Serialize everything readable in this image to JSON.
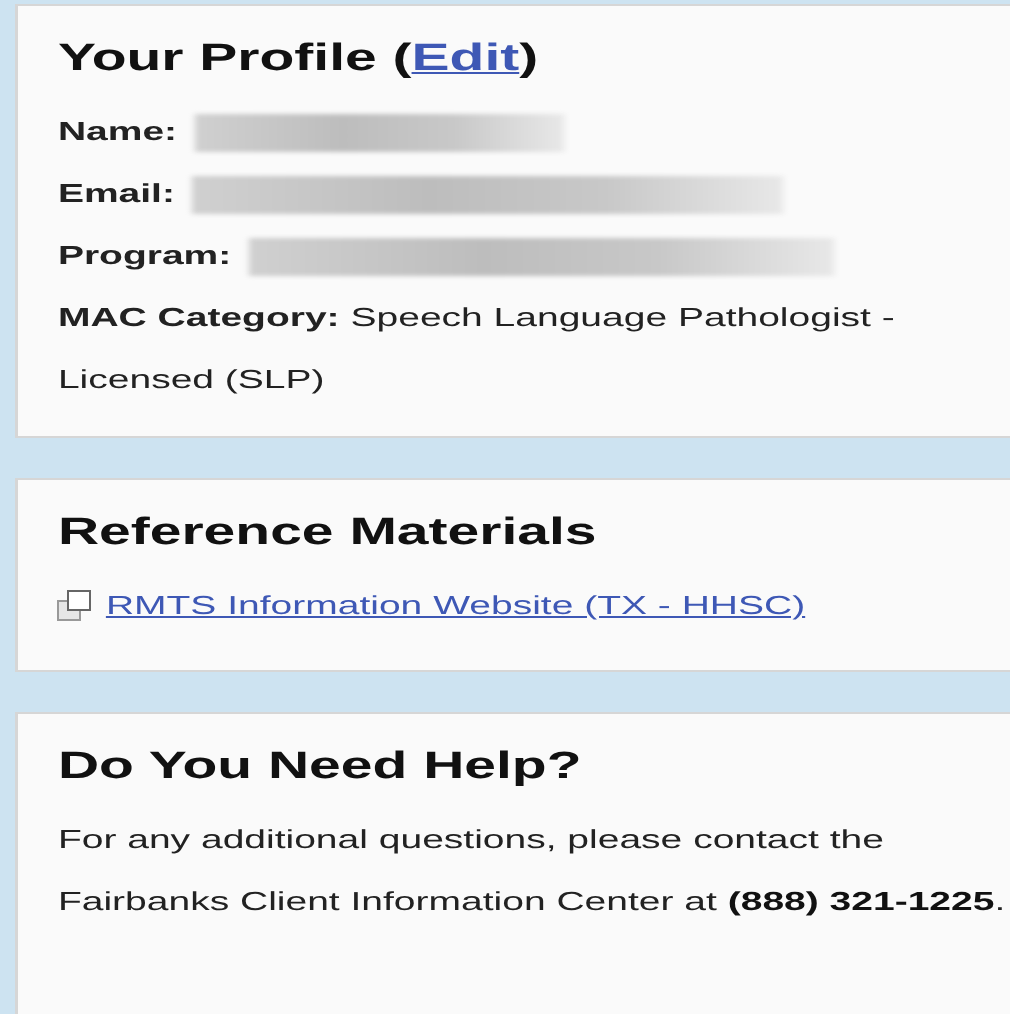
{
  "profile": {
    "title": "Your Profile (",
    "edit_link": "Edit",
    "title_end": ")",
    "fields": [
      {
        "label": "Name:",
        "redacted": true
      },
      {
        "label": "Email:",
        "redacted": true
      },
      {
        "label": "Program:",
        "redacted": true
      },
      {
        "label": "MAC Category:",
        "value": "Speech Language Pathologist - Licensed (SLP)",
        "redacted": false
      }
    ]
  },
  "reference": {
    "title": "Reference Materials",
    "links": [
      {
        "label": "RMTS Information Website (TX - HHSC)"
      }
    ]
  },
  "help": {
    "title": "Do You Need Help?",
    "text": "For any additional questions, please contact the Fairbanks Client Information Center at **(888) 321-1225**."
  }
}
